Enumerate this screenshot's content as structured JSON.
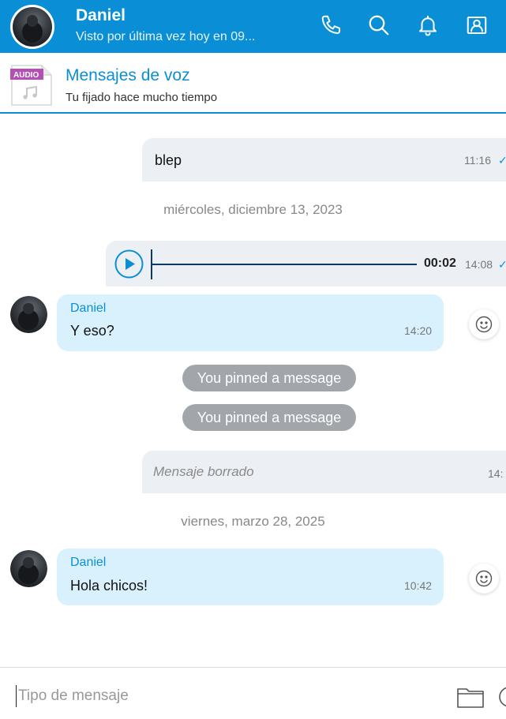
{
  "header": {
    "name": "Daniel",
    "status": "Visto por última vez hoy en 09..."
  },
  "pinned": {
    "file_label": "AUDIO",
    "title": "Mensajes de voz",
    "subtitle": "Tu fijado hace mucho tiempo"
  },
  "messages": {
    "m1": {
      "text": "blep",
      "time": "11:16"
    },
    "date1": "miércoles, diciembre 13, 2023",
    "audio": {
      "duration": "00:02",
      "time": "14:08"
    },
    "m2": {
      "sender": "Daniel",
      "text": "Y eso?",
      "time": "14:20"
    },
    "pin1": "You pinned a message",
    "pin2": "You pinned a message",
    "deleted": {
      "text": "Mensaje borrado",
      "time": "14:"
    },
    "date2": "viernes, marzo 28, 2025",
    "m3": {
      "sender": "Daniel",
      "text": "Hola chicos!",
      "time": "10:42"
    }
  },
  "composer": {
    "placeholder": "Tipo de mensaje"
  },
  "icons": {
    "call": "phone-icon",
    "search": "search-icon",
    "bell": "bell-icon",
    "contact": "contact-card-icon",
    "play": "play-icon",
    "emoji": "smiley-icon",
    "folder": "folder-icon"
  },
  "colors": {
    "brand": "#0a8fd6",
    "incoming_bubble": "#d9f1fd",
    "outgoing_bubble": "#eceff4",
    "pill": "#a2a6ab"
  }
}
